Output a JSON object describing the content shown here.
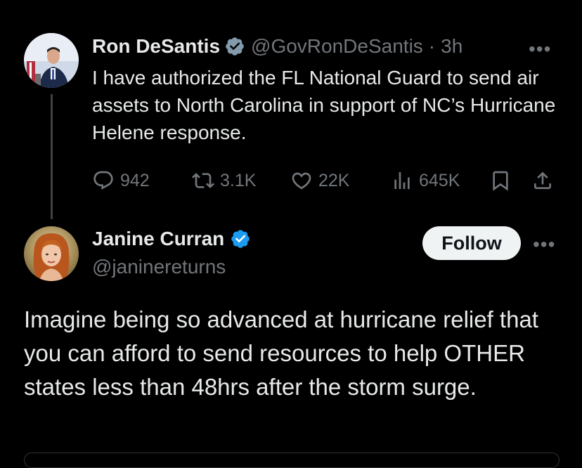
{
  "original_tweet": {
    "author_name": "Ron DeSantis",
    "handle": "@GovRonDeSantis",
    "separator": "·",
    "time": "3h",
    "text": "I have authorized the FL National Guard to send air assets to North Carolina in support of NC’s Hurricane Helene response.",
    "actions": {
      "replies": "942",
      "reposts": "3.1K",
      "likes": "22K",
      "views": "645K"
    },
    "icons": [
      "reply-icon",
      "repost-icon",
      "like-icon",
      "views-icon",
      "bookmark-icon",
      "share-icon"
    ]
  },
  "reply_tweet": {
    "author_name": "Janine Curran",
    "handle": "@janinereturns",
    "follow_label": "Follow",
    "text": "Imagine being so advanced at hurricane relief that you can afford to send resources to help OTHER states less than 48hrs after the storm surge."
  },
  "more_label": "•••",
  "colors": {
    "background": "#000000",
    "text_primary": "#e7e9ea",
    "text_secondary": "#71767b",
    "verified_gold": "#829aab",
    "verified_blue": "#1d9bf0",
    "follow_bg": "#eff3f4"
  }
}
